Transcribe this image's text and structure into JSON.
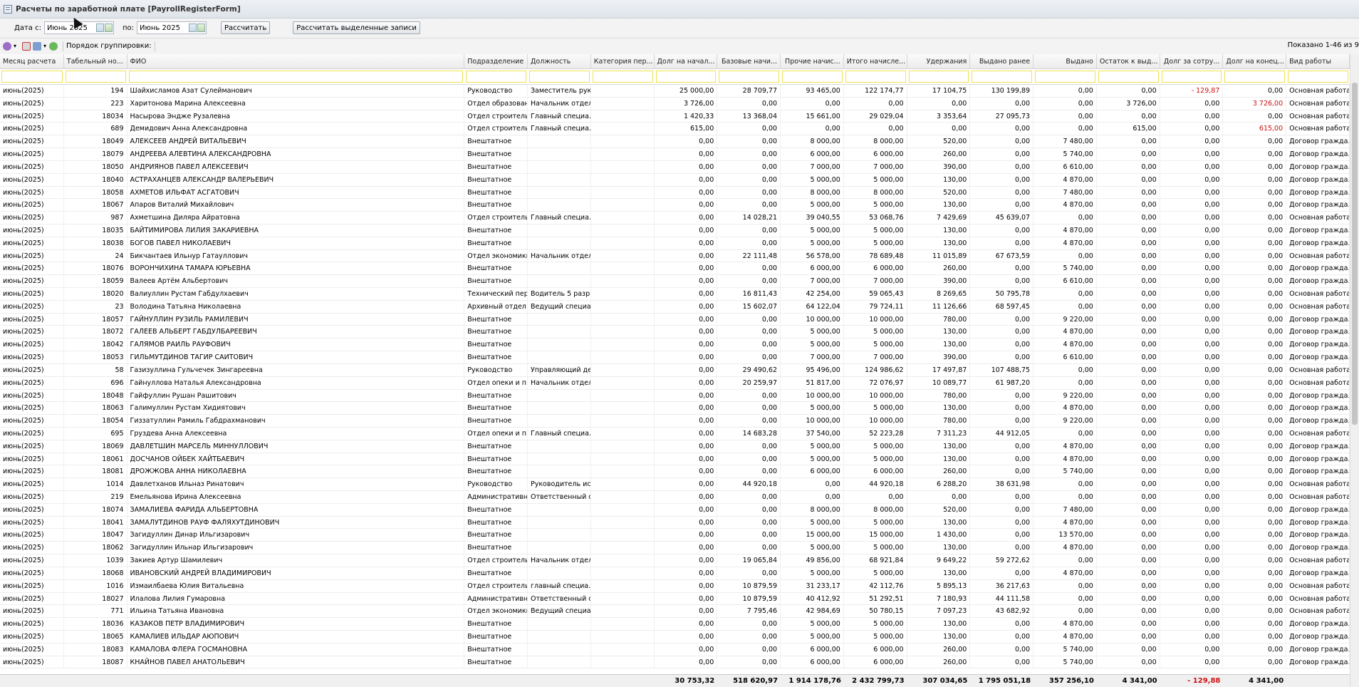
{
  "window": {
    "title": "Расчеты по заработной плате [PayrollRegisterForm]"
  },
  "filter": {
    "from_label": "Дата с:",
    "from_value": "Июнь 2025",
    "to_label": "по:",
    "to_value": "Июнь 2025",
    "calc_button": "Рассчитать",
    "calc_selected_button": "Рассчитать выделенные записи"
  },
  "toolbar": {
    "grouping_label": "Порядок группировки:",
    "showing": "Показано 1-46 из 9"
  },
  "columns": [
    "Месяц расчета",
    "Табельный но...",
    "ФИО",
    "Подразделение",
    "Должность",
    "Категория пер...",
    "Долг на начал...",
    "Базовые начи...",
    "Прочие начис...",
    "Итого начисле...",
    "Удержания",
    "Выдано ранее",
    "Выдано",
    "Остаток к выд...",
    "Долг за сотру...",
    "Долг на конец...",
    "Вид работы"
  ],
  "rows": [
    [
      "июнь(2025)",
      "194",
      "Шайхисламов Азат Сулейманович",
      "Руководство",
      "Заместитель рук...",
      "",
      "25 000,00",
      "28 709,77",
      "93 465,00",
      "122 174,77",
      "17 104,75",
      "130 199,89",
      "0,00",
      "0,00",
      "- 129,87",
      "0,00",
      "Основная работа"
    ],
    [
      "июнь(2025)",
      "223",
      "Харитонова Марина Алексеевна",
      "Отдел образован...",
      "Начальник отдела",
      "",
      "3 726,00",
      "0,00",
      "0,00",
      "0,00",
      "0,00",
      "0,00",
      "0,00",
      "3 726,00",
      "0,00",
      "3 726,00",
      "Основная работа"
    ],
    [
      "июнь(2025)",
      "18034",
      "Насырова Эндже Рузалевна",
      "Отдел строитель...",
      "Главный специа...",
      "",
      "1 420,33",
      "13 368,04",
      "15 661,00",
      "29 029,04",
      "3 353,64",
      "27 095,73",
      "0,00",
      "0,00",
      "0,00",
      "0,00",
      "Основная работа"
    ],
    [
      "июнь(2025)",
      "689",
      "Демидович Анна Александровна",
      "Отдел строитель...",
      "Главный специа...",
      "",
      "615,00",
      "0,00",
      "0,00",
      "0,00",
      "0,00",
      "0,00",
      "0,00",
      "615,00",
      "0,00",
      "615,00",
      "Основная работа"
    ],
    [
      "июнь(2025)",
      "18049",
      "АЛЕКСЕЕВ АНДРЕЙ ВИТАЛЬЕВИЧ",
      "Внештатное",
      "",
      "",
      "0,00",
      "0,00",
      "8 000,00",
      "8 000,00",
      "520,00",
      "0,00",
      "7 480,00",
      "0,00",
      "0,00",
      "0,00",
      "Договор гражда..."
    ],
    [
      "июнь(2025)",
      "18079",
      "АНДРЕЕВА АЛЕВТИНА АЛЕКСАНДРОВНА",
      "Внештатное",
      "",
      "",
      "0,00",
      "0,00",
      "6 000,00",
      "6 000,00",
      "260,00",
      "0,00",
      "5 740,00",
      "0,00",
      "0,00",
      "0,00",
      "Договор гражда..."
    ],
    [
      "июнь(2025)",
      "18050",
      "АНДРИЯНОВ ПАВЕЛ АЛЕКСЕЕВИЧ",
      "Внештатное",
      "",
      "",
      "0,00",
      "0,00",
      "7 000,00",
      "7 000,00",
      "390,00",
      "0,00",
      "6 610,00",
      "0,00",
      "0,00",
      "0,00",
      "Договор гражда..."
    ],
    [
      "июнь(2025)",
      "18040",
      "АСТРАХАНЦЕВ АЛЕКСАНДР ВАЛЕРЬЕВИЧ",
      "Внештатное",
      "",
      "",
      "0,00",
      "0,00",
      "5 000,00",
      "5 000,00",
      "130,00",
      "0,00",
      "4 870,00",
      "0,00",
      "0,00",
      "0,00",
      "Договор гражда..."
    ],
    [
      "июнь(2025)",
      "18058",
      "АХМЕТОВ ИЛЬФАТ АСГАТОВИЧ",
      "Внештатное",
      "",
      "",
      "0,00",
      "0,00",
      "8 000,00",
      "8 000,00",
      "520,00",
      "0,00",
      "7 480,00",
      "0,00",
      "0,00",
      "0,00",
      "Договор гражда..."
    ],
    [
      "июнь(2025)",
      "18067",
      "Апаров Виталий Михайлович",
      "Внештатное",
      "",
      "",
      "0,00",
      "0,00",
      "5 000,00",
      "5 000,00",
      "130,00",
      "0,00",
      "4 870,00",
      "0,00",
      "0,00",
      "0,00",
      "Договор гражда..."
    ],
    [
      "июнь(2025)",
      "987",
      "Ахметшина Диляра Айратовна",
      "Отдел строитель...",
      "Главный специа...",
      "",
      "0,00",
      "14 028,21",
      "39 040,55",
      "53 068,76",
      "7 429,69",
      "45 639,07",
      "0,00",
      "0,00",
      "0,00",
      "0,00",
      "Основная работа"
    ],
    [
      "июнь(2025)",
      "18035",
      "БАЙТИМИРОВА ЛИЛИЯ ЗАКАРИЕВНА",
      "Внештатное",
      "",
      "",
      "0,00",
      "0,00",
      "5 000,00",
      "5 000,00",
      "130,00",
      "0,00",
      "4 870,00",
      "0,00",
      "0,00",
      "0,00",
      "Договор гражда..."
    ],
    [
      "июнь(2025)",
      "18038",
      "БОГОВ ПАВЕЛ НИКОЛАЕВИЧ",
      "Внештатное",
      "",
      "",
      "0,00",
      "0,00",
      "5 000,00",
      "5 000,00",
      "130,00",
      "0,00",
      "4 870,00",
      "0,00",
      "0,00",
      "0,00",
      "Договор гражда..."
    ],
    [
      "июнь(2025)",
      "24",
      "Бикчантаев Ильнур Гатауллович",
      "Отдел экономики",
      "Начальник отдела",
      "",
      "0,00",
      "22 111,48",
      "56 578,00",
      "78 689,48",
      "11 015,89",
      "67 673,59",
      "0,00",
      "0,00",
      "0,00",
      "0,00",
      "Основная работа"
    ],
    [
      "июнь(2025)",
      "18076",
      "ВОРОНЧИХИНА ТАМАРА ЮРЬЕВНА",
      "Внештатное",
      "",
      "",
      "0,00",
      "0,00",
      "6 000,00",
      "6 000,00",
      "260,00",
      "0,00",
      "5 740,00",
      "0,00",
      "0,00",
      "0,00",
      "Договор гражда..."
    ],
    [
      "июнь(2025)",
      "18059",
      "Валеев Артём Альбертович",
      "Внештатное",
      "",
      "",
      "0,00",
      "0,00",
      "7 000,00",
      "7 000,00",
      "390,00",
      "0,00",
      "6 610,00",
      "0,00",
      "0,00",
      "0,00",
      "Договор гражда..."
    ],
    [
      "июнь(2025)",
      "18020",
      "Валиуллин Рустам Габдулхаевич",
      "Технический пер...",
      "Водитель 5 разр...",
      "",
      "0,00",
      "16 811,43",
      "42 254,00",
      "59 065,43",
      "8 269,65",
      "50 795,78",
      "0,00",
      "0,00",
      "0,00",
      "0,00",
      "Основная работа"
    ],
    [
      "июнь(2025)",
      "23",
      "Володина Татьяна Николаевна",
      "Архивный отдел",
      "Ведущий специа...",
      "",
      "0,00",
      "15 602,07",
      "64 122,04",
      "79 724,11",
      "11 126,66",
      "68 597,45",
      "0,00",
      "0,00",
      "0,00",
      "0,00",
      "Основная работа"
    ],
    [
      "июнь(2025)",
      "18057",
      "ГАЙНУЛЛИН РУЗИЛЬ РАМИЛЕВИЧ",
      "Внештатное",
      "",
      "",
      "0,00",
      "0,00",
      "10 000,00",
      "10 000,00",
      "780,00",
      "0,00",
      "9 220,00",
      "0,00",
      "0,00",
      "0,00",
      "Договор гражда..."
    ],
    [
      "июнь(2025)",
      "18072",
      "ГАЛЕЕВ АЛЬБЕРТ ГАБДУЛБАРЕЕВИЧ",
      "Внештатное",
      "",
      "",
      "0,00",
      "0,00",
      "5 000,00",
      "5 000,00",
      "130,00",
      "0,00",
      "4 870,00",
      "0,00",
      "0,00",
      "0,00",
      "Договор гражда..."
    ],
    [
      "июнь(2025)",
      "18042",
      "ГАЛЯМОВ РАИЛЬ РАУФОВИЧ",
      "Внештатное",
      "",
      "",
      "0,00",
      "0,00",
      "5 000,00",
      "5 000,00",
      "130,00",
      "0,00",
      "4 870,00",
      "0,00",
      "0,00",
      "0,00",
      "Договор гражда..."
    ],
    [
      "июнь(2025)",
      "18053",
      "ГИЛЬМУТДИНОВ ТАГИР САИТОВИЧ",
      "Внештатное",
      "",
      "",
      "0,00",
      "0,00",
      "7 000,00",
      "7 000,00",
      "390,00",
      "0,00",
      "6 610,00",
      "0,00",
      "0,00",
      "0,00",
      "Договор гражда..."
    ],
    [
      "июнь(2025)",
      "58",
      "Газизуллина Гульчечек Зингареевна",
      "Руководство",
      "Управляющий де...",
      "",
      "0,00",
      "29 490,62",
      "95 496,00",
      "124 986,62",
      "17 497,87",
      "107 488,75",
      "0,00",
      "0,00",
      "0,00",
      "0,00",
      "Основная работа"
    ],
    [
      "июнь(2025)",
      "696",
      "Гайнуллова Наталья Александровна",
      "Отдел опеки и п...",
      "Начальник отдела",
      "",
      "0,00",
      "20 259,97",
      "51 817,00",
      "72 076,97",
      "10 089,77",
      "61 987,20",
      "0,00",
      "0,00",
      "0,00",
      "0,00",
      "Основная работа"
    ],
    [
      "июнь(2025)",
      "18048",
      "Гайфуллин Рушан Рашитович",
      "Внештатное",
      "",
      "",
      "0,00",
      "0,00",
      "10 000,00",
      "10 000,00",
      "780,00",
      "0,00",
      "9 220,00",
      "0,00",
      "0,00",
      "0,00",
      "Договор гражда..."
    ],
    [
      "июнь(2025)",
      "18063",
      "Галимуллин Рустам Хидиятович",
      "Внештатное",
      "",
      "",
      "0,00",
      "0,00",
      "5 000,00",
      "5 000,00",
      "130,00",
      "0,00",
      "4 870,00",
      "0,00",
      "0,00",
      "0,00",
      "Договор гражда..."
    ],
    [
      "июнь(2025)",
      "18054",
      "Гиззатуллин Рамиль Габдрахманович",
      "Внештатное",
      "",
      "",
      "0,00",
      "0,00",
      "10 000,00",
      "10 000,00",
      "780,00",
      "0,00",
      "9 220,00",
      "0,00",
      "0,00",
      "0,00",
      "Договор гражда..."
    ],
    [
      "июнь(2025)",
      "695",
      "Груздева Анна Алексеевна",
      "Отдел опеки и п...",
      "Главный специа...",
      "",
      "0,00",
      "14 683,28",
      "37 540,00",
      "52 223,28",
      "7 311,23",
      "44 912,05",
      "0,00",
      "0,00",
      "0,00",
      "0,00",
      "Основная работа"
    ],
    [
      "июнь(2025)",
      "18069",
      "ДАВЛЕТШИН МАРСЕЛЬ МИННУЛЛОВИЧ",
      "Внештатное",
      "",
      "",
      "0,00",
      "0,00",
      "5 000,00",
      "5 000,00",
      "130,00",
      "0,00",
      "4 870,00",
      "0,00",
      "0,00",
      "0,00",
      "Договор гражда..."
    ],
    [
      "июнь(2025)",
      "18061",
      "ДОСЧАНОВ ОЙБЕК ХАЙТБАЕВИЧ",
      "Внештатное",
      "",
      "",
      "0,00",
      "0,00",
      "5 000,00",
      "5 000,00",
      "130,00",
      "0,00",
      "4 870,00",
      "0,00",
      "0,00",
      "0,00",
      "Договор гражда..."
    ],
    [
      "июнь(2025)",
      "18081",
      "ДРОЖЖОВА АННА НИКОЛАЕВНА",
      "Внештатное",
      "",
      "",
      "0,00",
      "0,00",
      "6 000,00",
      "6 000,00",
      "260,00",
      "0,00",
      "5 740,00",
      "0,00",
      "0,00",
      "0,00",
      "Договор гражда..."
    ],
    [
      "июнь(2025)",
      "1014",
      "Давлетханов Ильназ Ринатович",
      "Руководство",
      "Руководитель ис...",
      "",
      "0,00",
      "44 920,18",
      "0,00",
      "44 920,18",
      "6 288,20",
      "38 631,98",
      "0,00",
      "0,00",
      "0,00",
      "0,00",
      "Основная работа"
    ],
    [
      "июнь(2025)",
      "219",
      "Емельянова Ирина Алексеевна",
      "Административн...",
      "Ответственный с...",
      "",
      "0,00",
      "0,00",
      "0,00",
      "0,00",
      "0,00",
      "0,00",
      "0,00",
      "0,00",
      "0,00",
      "0,00",
      "Основная работа"
    ],
    [
      "июнь(2025)",
      "18074",
      "ЗАМАЛИЕВА ФАРИДА АЛЬБЕРТОВНА",
      "Внештатное",
      "",
      "",
      "0,00",
      "0,00",
      "8 000,00",
      "8 000,00",
      "520,00",
      "0,00",
      "7 480,00",
      "0,00",
      "0,00",
      "0,00",
      "Договор гражда..."
    ],
    [
      "июнь(2025)",
      "18041",
      "ЗАМАЛУТДИНОВ РАУФ ФАЛЯХУТДИНОВИЧ",
      "Внештатное",
      "",
      "",
      "0,00",
      "0,00",
      "5 000,00",
      "5 000,00",
      "130,00",
      "0,00",
      "4 870,00",
      "0,00",
      "0,00",
      "0,00",
      "Договор гражда..."
    ],
    [
      "июнь(2025)",
      "18047",
      "Загидуллин Динар Ильгизарович",
      "Внештатное",
      "",
      "",
      "0,00",
      "0,00",
      "15 000,00",
      "15 000,00",
      "1 430,00",
      "0,00",
      "13 570,00",
      "0,00",
      "0,00",
      "0,00",
      "Договор гражда..."
    ],
    [
      "июнь(2025)",
      "18062",
      "Загидуллин Ильнар Ильгизарович",
      "Внештатное",
      "",
      "",
      "0,00",
      "0,00",
      "5 000,00",
      "5 000,00",
      "130,00",
      "0,00",
      "4 870,00",
      "0,00",
      "0,00",
      "0,00",
      "Договор гражда..."
    ],
    [
      "июнь(2025)",
      "1039",
      "Закиев Артур Шамилевич",
      "Отдел строитель...",
      "Начальник отдела",
      "",
      "0,00",
      "19 065,84",
      "49 856,00",
      "68 921,84",
      "9 649,22",
      "59 272,62",
      "0,00",
      "0,00",
      "0,00",
      "0,00",
      "Основная работа"
    ],
    [
      "июнь(2025)",
      "18068",
      "ИВАНОВСКИЙ АНДРЕЙ ВЛАДИМИРОВИЧ",
      "Внештатное",
      "",
      "",
      "0,00",
      "0,00",
      "5 000,00",
      "5 000,00",
      "130,00",
      "0,00",
      "4 870,00",
      "0,00",
      "0,00",
      "0,00",
      "Договор гражда..."
    ],
    [
      "июнь(2025)",
      "1016",
      "Измаилбаева Юлия Витальевна",
      "Отдел строитель...",
      "главный специа...",
      "",
      "0,00",
      "10 879,59",
      "31 233,17",
      "42 112,76",
      "5 895,13",
      "36 217,63",
      "0,00",
      "0,00",
      "0,00",
      "0,00",
      "Основная работа"
    ],
    [
      "июнь(2025)",
      "18027",
      "Илалова Лилия Гумаровна",
      "Административн...",
      "Ответственный с...",
      "",
      "0,00",
      "10 879,59",
      "40 412,92",
      "51 292,51",
      "7 180,93",
      "44 111,58",
      "0,00",
      "0,00",
      "0,00",
      "0,00",
      "Основная работа"
    ],
    [
      "июнь(2025)",
      "771",
      "Ильина Татьяна Ивановна",
      "Отдел экономики",
      "Ведущий специа...",
      "",
      "0,00",
      "7 795,46",
      "42 984,69",
      "50 780,15",
      "7 097,23",
      "43 682,92",
      "0,00",
      "0,00",
      "0,00",
      "0,00",
      "Основная работа"
    ],
    [
      "июнь(2025)",
      "18036",
      "КАЗАКОВ ПЕТР ВЛАДИМИРОВИЧ",
      "Внештатное",
      "",
      "",
      "0,00",
      "0,00",
      "5 000,00",
      "5 000,00",
      "130,00",
      "0,00",
      "4 870,00",
      "0,00",
      "0,00",
      "0,00",
      "Договор гражда..."
    ],
    [
      "июнь(2025)",
      "18065",
      "КАМАЛИЕВ ИЛЬДАР АЮПОВИЧ",
      "Внештатное",
      "",
      "",
      "0,00",
      "0,00",
      "5 000,00",
      "5 000,00",
      "130,00",
      "0,00",
      "4 870,00",
      "0,00",
      "0,00",
      "0,00",
      "Договор гражда..."
    ],
    [
      "июнь(2025)",
      "18083",
      "КАМАЛОВА ФЛЕРА ГОСМАНОВНА",
      "Внештатное",
      "",
      "",
      "0,00",
      "0,00",
      "6 000,00",
      "6 000,00",
      "260,00",
      "0,00",
      "5 740,00",
      "0,00",
      "0,00",
      "0,00",
      "Договор гражда..."
    ],
    [
      "июнь(2025)",
      "18087",
      "КНАЙНОВ ПАВЕЛ АНАТОЛЬЕВИЧ",
      "Внештатное",
      "",
      "",
      "0,00",
      "0,00",
      "6 000,00",
      "6 000,00",
      "260,00",
      "0,00",
      "5 740,00",
      "0,00",
      "0,00",
      "0,00",
      "Договор гражда..."
    ]
  ],
  "totals": [
    "",
    "",
    "",
    "",
    "",
    "",
    "30 753,32",
    "518 620,97",
    "1 914 178,76",
    "2 432 799,73",
    "307 034,65",
    "1 795 051,18",
    "357 256,10",
    "4 341,00",
    "- 129,88",
    "4 341,00",
    ""
  ],
  "colors": {
    "negative": "#d01010",
    "filter_border": "#efe24e"
  }
}
